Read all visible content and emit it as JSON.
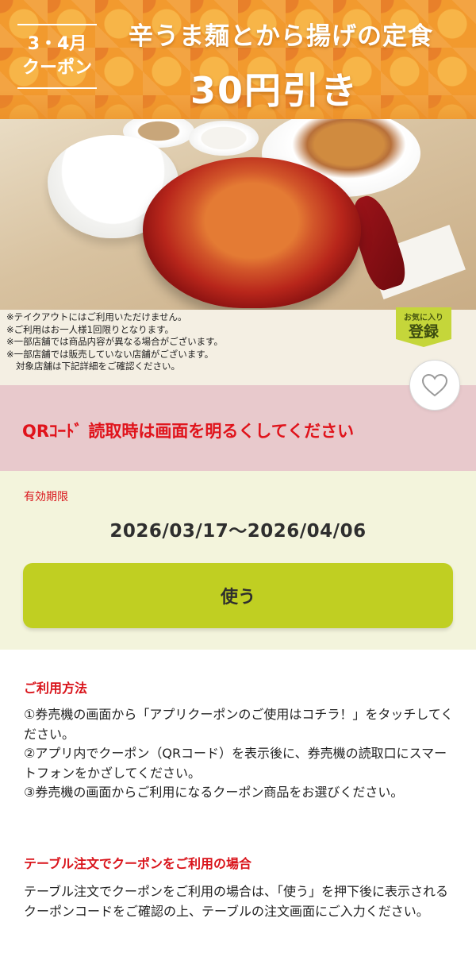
{
  "banner": {
    "month_line1": "3・4月",
    "month_line2": "クーポン",
    "headline": "辛うま麺とから揚げの定食",
    "discount": "30円引き",
    "notes": [
      "※テイクアウトにはご利用いただけません。",
      "※ご利用はお一人様1回限りとなります。",
      "※一部店舗では商品内容が異なる場合がございます。",
      "※一部店舗では販売していない店舗がございます。",
      "対象店舗は下記詳細をご確認ください。"
    ],
    "favorite_badge": {
      "small": "お気に入り",
      "big": "登録"
    }
  },
  "icons": {
    "favorite": "heart-outline-icon"
  },
  "qr_notice": "QRｺｰﾄﾞ 読取時は画面を明るくしてください",
  "validity": {
    "label": "有効期限",
    "range": "2026/03/17～2026/04/06"
  },
  "use_button": "使う",
  "howto": {
    "title": "ご利用方法",
    "steps": [
      "①券売機の画面から「アプリクーポンのご使用はコチラ！」をタッチしてください。",
      "②アプリ内でクーポン（QRコード）を表示後に、券売機の読取口にスマートフォンをかざしてください。",
      "③券売機の画面からご利用になるクーポン商品をお選びください。"
    ]
  },
  "table_order": {
    "title": "テーブル注文でクーポンをご利用の場合",
    "text": "テーブル注文でクーポンをご利用の場合は、「使う」を押下後に表示されるクーポンコードをご確認の上、テーブルの注文画面にご入力ください。"
  },
  "colors": {
    "accent_red": "#d9141b",
    "use_button": "#c0cf22",
    "qr_band": "#e8c9cc",
    "validity_bg": "#f3f4dc",
    "banner_orange": "#f29a2e"
  }
}
